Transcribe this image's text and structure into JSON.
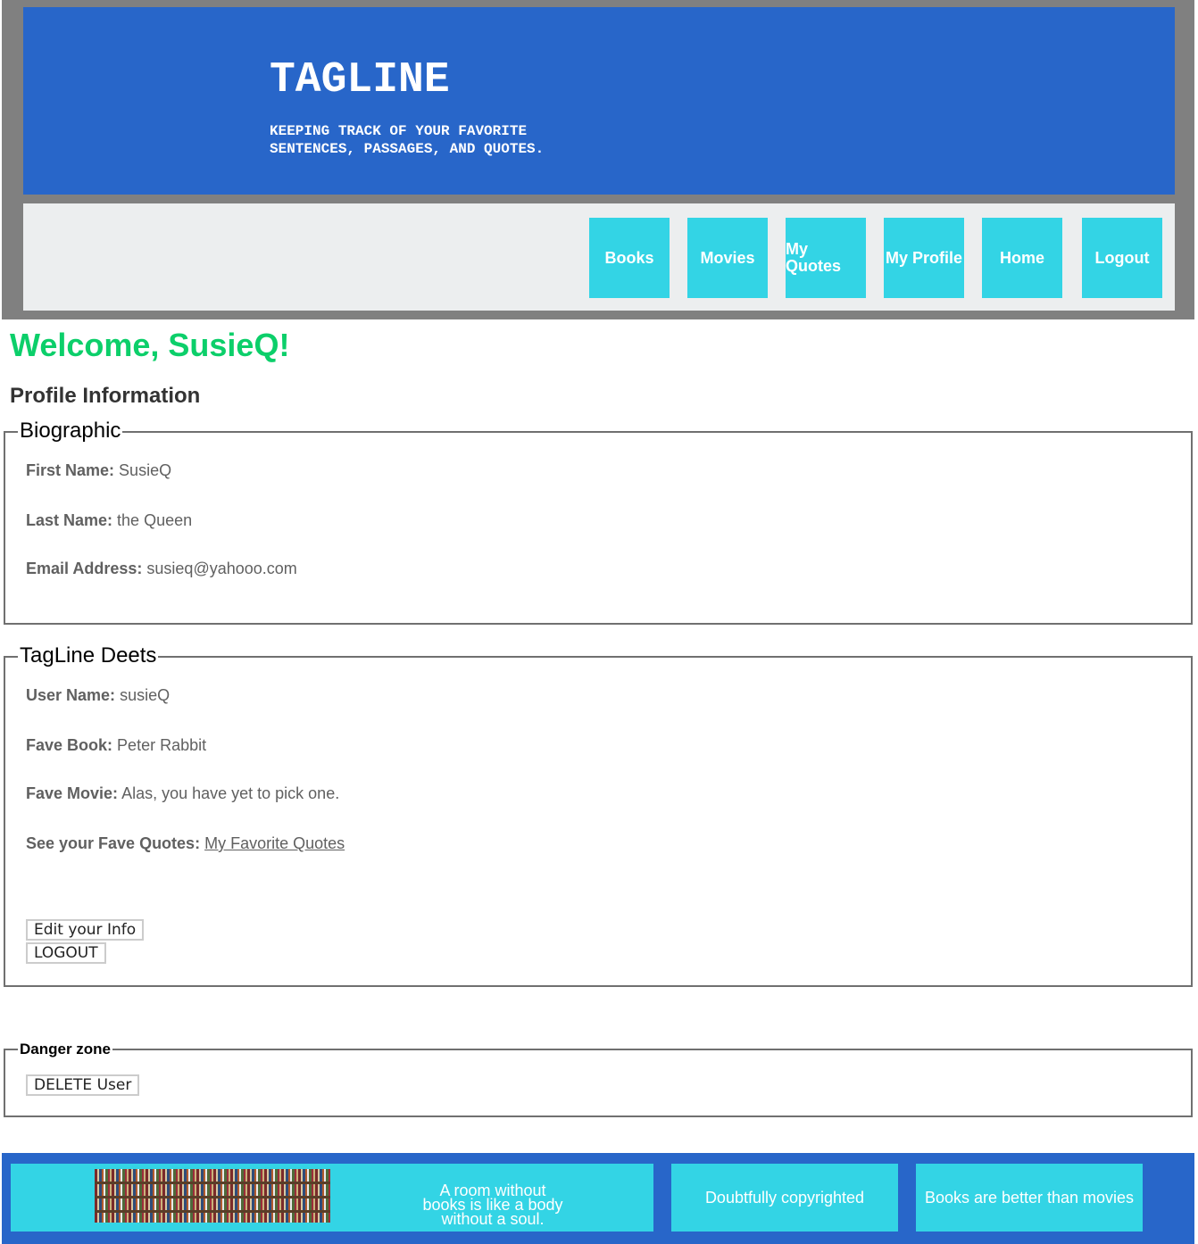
{
  "header": {
    "title": "TAGLINE",
    "tagline": "KEEPING TRACK OF YOUR FAVORITE SENTENCES, PASSAGES, AND QUOTES."
  },
  "nav": {
    "items": [
      {
        "label": "Books"
      },
      {
        "label": "Movies"
      },
      {
        "label": "My Quotes"
      },
      {
        "label": "My Profile"
      },
      {
        "label": "Home"
      },
      {
        "label": "Logout"
      }
    ]
  },
  "main": {
    "welcome": "Welcome, SusieQ!",
    "profile_heading": "Profile Information"
  },
  "biographic": {
    "legend": "Biographic",
    "first_name_label": "First Name:",
    "first_name": "SusieQ",
    "last_name_label": "Last Name:",
    "last_name": "the Queen",
    "email_label": "Email Address:",
    "email": "susieq@yahooo.com"
  },
  "deets": {
    "legend": "TagLine Deets",
    "user_name_label": "User Name:",
    "user_name": "susieQ",
    "fave_book_label": "Fave Book:",
    "fave_book": "Peter Rabbit",
    "fave_movie_label": "Fave Movie:",
    "fave_movie": "Alas, you have yet to pick one.",
    "fave_quotes_label": "See your Fave Quotes:",
    "fave_quotes_link": "My Favorite Quotes",
    "edit_button": "Edit your Info",
    "logout_button": "LOGOUT"
  },
  "danger": {
    "legend": "Danger zone",
    "delete_button": "DELETE User"
  },
  "footer": {
    "quote": "A room without books is like a body without a soul.",
    "copyright": "Doubtfully copyrighted",
    "motto": "Books are better than movies"
  },
  "colors": {
    "banner_blue": "#2866c9",
    "nav_cyan": "#33d4e5",
    "welcome_green": "#0ccf6a",
    "frame_gray": "#808080"
  }
}
